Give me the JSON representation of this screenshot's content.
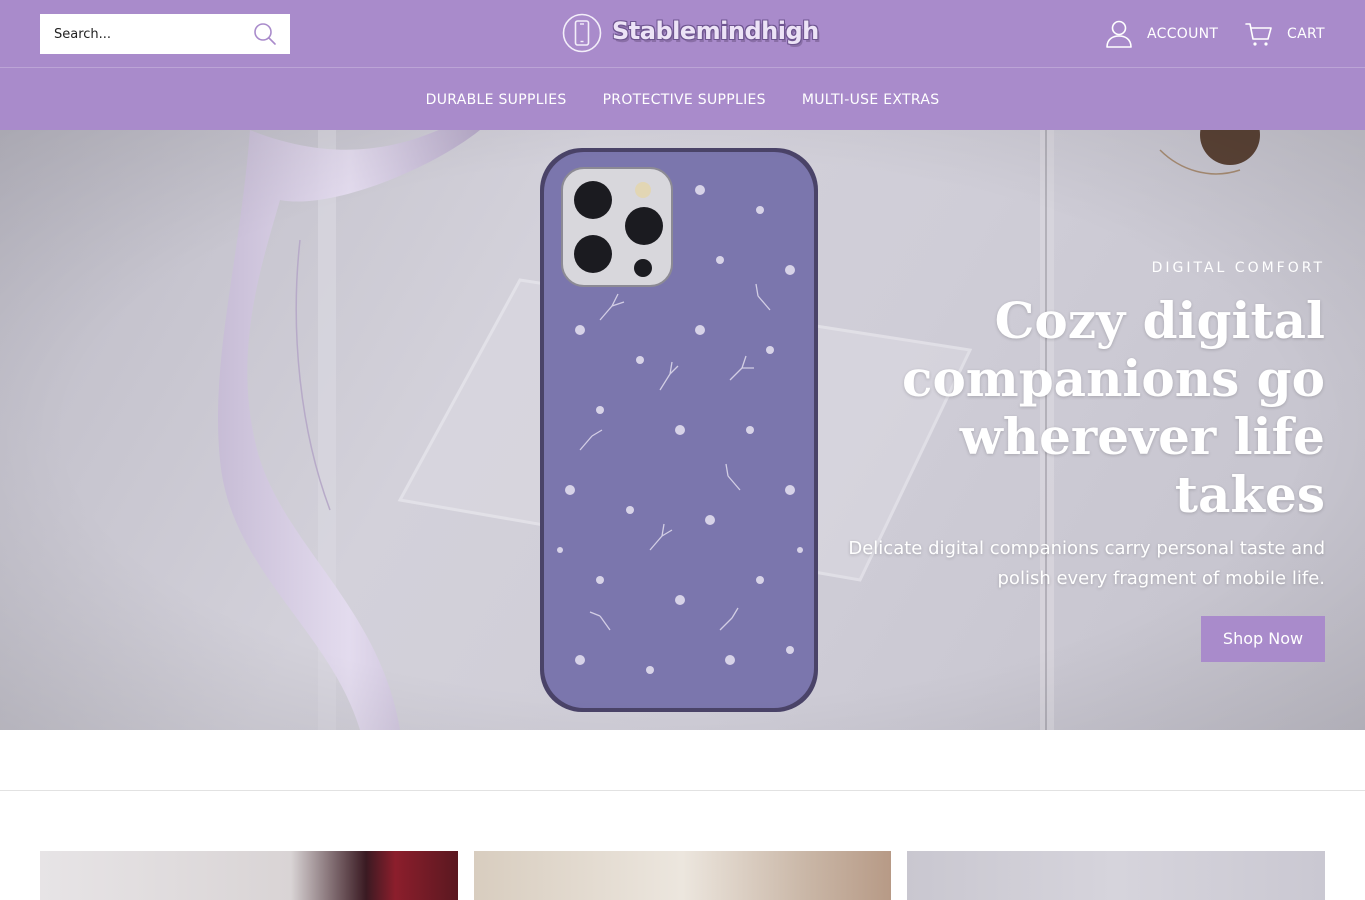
{
  "header": {
    "search": {
      "placeholder": "Search..."
    },
    "logo_text": "Stablemindhigh",
    "account_label": "ACCOUNT",
    "cart_label": "CART",
    "background_color": "#a98bcb"
  },
  "nav": {
    "items": [
      {
        "label": "DURABLE SUPPLIES"
      },
      {
        "label": "PROTECTIVE SUPPLIES"
      },
      {
        "label": "MULTI-USE EXTRAS"
      }
    ]
  },
  "hero": {
    "eyebrow": "DIGITAL COMFORT",
    "title": "Cozy digital companions go wherever life takes",
    "subtitle": "Delicate digital companions carry personal taste and polish every fragment of mobile life.",
    "button_label": "Shop Now",
    "button_color": "#a98bcb"
  },
  "icons": {
    "search": "search-icon",
    "logo": "phone-logo-icon",
    "account": "user-icon",
    "cart": "cart-icon"
  }
}
